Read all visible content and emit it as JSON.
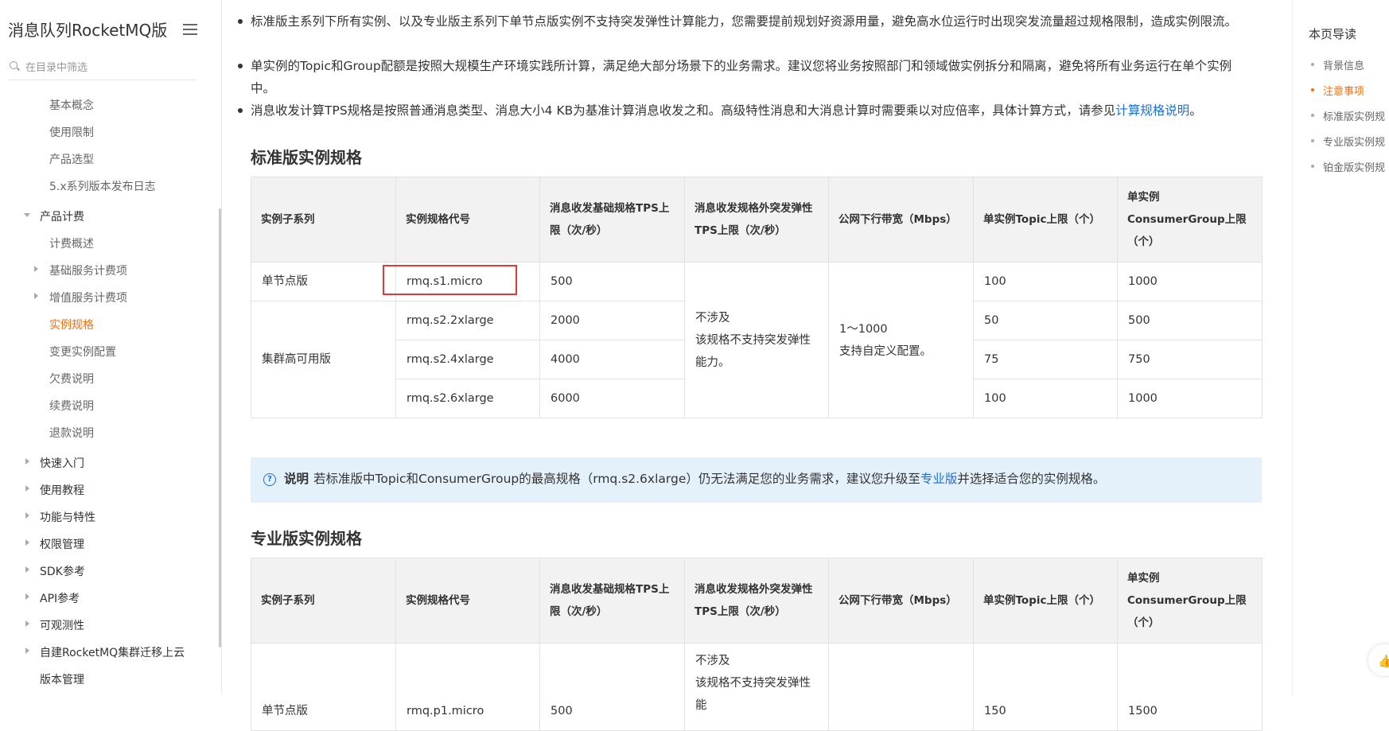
{
  "sidebar": {
    "title": "消息队列RocketMQ版",
    "search_placeholder": "在目录中筛选",
    "items": [
      {
        "label": "基本概念"
      },
      {
        "label": "使用限制"
      },
      {
        "label": "产品选型"
      },
      {
        "label": "5.x系列版本发布日志"
      },
      {
        "label": "产品计费"
      },
      {
        "label": "计费概述"
      },
      {
        "label": "基础服务计费项"
      },
      {
        "label": "增值服务计费项"
      },
      {
        "label": "实例规格"
      },
      {
        "label": "变更实例配置"
      },
      {
        "label": "欠费说明"
      },
      {
        "label": "续费说明"
      },
      {
        "label": "退款说明"
      },
      {
        "label": "快速入门"
      },
      {
        "label": "使用教程"
      },
      {
        "label": "功能与特性"
      },
      {
        "label": "权限管理"
      },
      {
        "label": "SDK参考"
      },
      {
        "label": "API参考"
      },
      {
        "label": "可观测性"
      },
      {
        "label": "自建RocketMQ集群迁移上云"
      },
      {
        "label": "版本管理"
      }
    ]
  },
  "content": {
    "bullets": [
      {
        "text": "标准版主系列下所有实例、以及专业版主系列下单节点版实例不支持突发弹性计算能力，您需要提前规划好资源用量，避免高水位运行时出现突发流量超过规格限制，造成实例限流。"
      },
      {
        "text": "单实例的Topic和Group配额是按照大规模生产环境实践所计算，满足绝大部分场景下的业务需求。建议您将业务按照部门和领域做实例拆分和隔离，避免将所有业务运行在单个实例中。"
      },
      {
        "text": "消息收发计算TPS规格是按照普通消息类型、消息大小4 KB为基准计算消息收发之和。高级特性消息和大消息计算时需要乘以对应倍率，具体计算方式，请参见",
        "link": "计算规格说明",
        "suffix": "。"
      }
    ],
    "standard_heading": "标准版实例规格",
    "pro_heading": "专业版实例规格",
    "columns": [
      "实例子系列",
      "实例规格代号",
      "消息收发基础规格TPS上限（次/秒）",
      "消息收发规格外突发弹性TPS上限（次/秒）",
      "公网下行带宽（Mbps）",
      "单实例Topic上限（个）",
      "单实例ConsumerGroup上限（个）"
    ],
    "standard_table": {
      "single_node_label": "单节点版",
      "cluster_label": "集群高可用版",
      "burst_line1": "不涉及",
      "burst_line2": "该规格不支持突发弹性能力。",
      "bandwidth_line1": "1～1000",
      "bandwidth_line2": "支持自定义配置。",
      "rows": [
        {
          "code": "rmq.s1.micro",
          "tps": "500",
          "topic": "100",
          "group": "1000"
        },
        {
          "code": "rmq.s2.2xlarge",
          "tps": "2000",
          "topic": "50",
          "group": "500"
        },
        {
          "code": "rmq.s2.4xlarge",
          "tps": "4000",
          "topic": "75",
          "group": "750"
        },
        {
          "code": "rmq.s2.6xlarge",
          "tps": "6000",
          "topic": "100",
          "group": "1000"
        }
      ]
    },
    "note": {
      "label": "说明",
      "text": "若标准版中Topic和ConsumerGroup的最高规格（rmq.s2.6xlarge）仍无法满足您的业务需求，建议您升级至",
      "link": "专业版",
      "suffix": "并选择适合您的实例规格。"
    },
    "pro_table": {
      "rows": [
        {
          "series": "单节点版",
          "code": "rmq.p1.micro",
          "tps": "500",
          "burst_line1": "不涉及",
          "burst_line2": "该规格不支持突发弹性能",
          "topic": "150",
          "group": "1500"
        }
      ]
    }
  },
  "toc": {
    "title": "本页导读",
    "items": [
      {
        "label": "背景信息"
      },
      {
        "label": "注意事项"
      },
      {
        "label": "标准版实例规"
      },
      {
        "label": "专业版实例规"
      },
      {
        "label": "铂金版实例规"
      }
    ]
  },
  "colors": {
    "accent": "#ff6a00",
    "link": "#1f6fd8",
    "note_bg": "#e4f1fb",
    "highlight_box": "#e53935"
  }
}
